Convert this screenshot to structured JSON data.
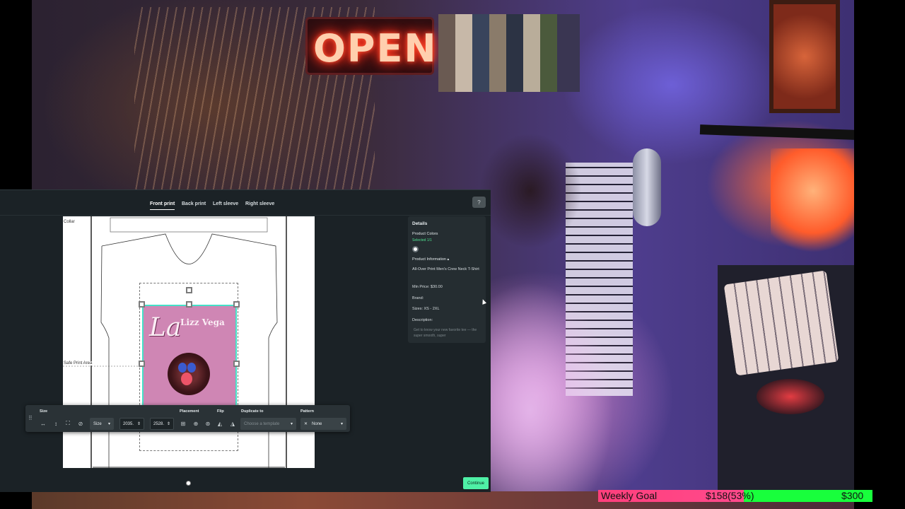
{
  "editor": {
    "tabs": [
      {
        "label": "Front print",
        "active": true
      },
      {
        "label": "Back print",
        "active": false
      },
      {
        "label": "Left sleeve",
        "active": false
      },
      {
        "label": "Right sleeve",
        "active": false
      }
    ],
    "help_icon": "question-circle-icon",
    "canvas": {
      "collar_label": "Collar",
      "safe_area_label": "Safe Print Area",
      "artwork_script": "La",
      "artwork_name": "Lizz Vega"
    },
    "details": {
      "title": "Details",
      "product_colors_label": "Product Colors",
      "selected_count": "Selected 1/1",
      "product_information_label": "Product Information",
      "product_name": "All-Over Print Men's Crew Neck T-Shirt",
      "min_price": "Min Price: $30.00",
      "brand": "Brand:",
      "sizes": "Sizes: XS - 2XL",
      "description_label": "Description:",
      "description_text": "Get to know your new favorite tee — the super smooth, super"
    },
    "toolbar": {
      "size_section": "Size",
      "placement_section": "Placement",
      "flip_section": "Flip",
      "duplicate_section": "Duplicate to",
      "pattern_section": "Pattern",
      "size_select": "Size",
      "width_value": "2035.",
      "height_value": "2528.",
      "duplicate_placeholder": "Choose a template",
      "pattern_value": "None"
    },
    "continue_label": "Continue"
  },
  "goal": {
    "label": "Weekly Goal",
    "progress_text": "$158(53%)",
    "target": "$300",
    "progress_fraction": 0.53,
    "fill_color": "#ff4a8c",
    "bar_color": "#18ff3c"
  },
  "scene": {
    "neon_sign": "OPEN"
  }
}
